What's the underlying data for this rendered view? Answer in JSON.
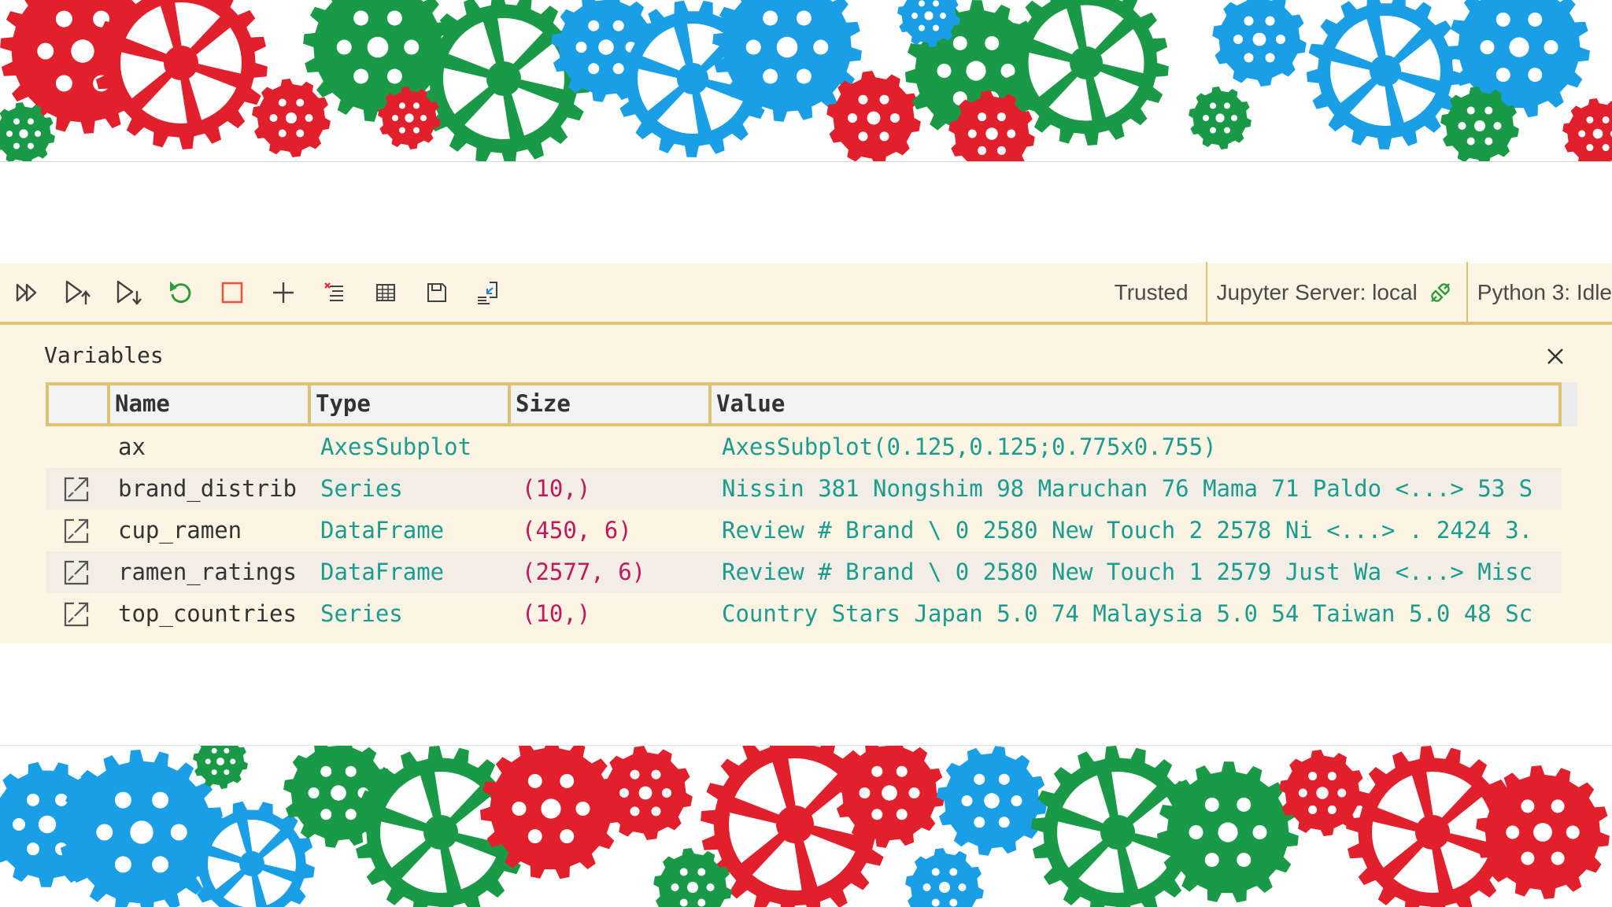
{
  "toolbar": {
    "buttons": [
      {
        "name": "run-all-icon"
      },
      {
        "name": "run-above-icon"
      },
      {
        "name": "run-below-icon"
      },
      {
        "name": "restart-kernel-icon"
      },
      {
        "name": "interrupt-kernel-icon"
      },
      {
        "name": "add-cell-icon"
      },
      {
        "name": "clear-outputs-icon"
      },
      {
        "name": "variables-icon"
      },
      {
        "name": "save-icon"
      },
      {
        "name": "export-icon"
      }
    ],
    "trusted": "Trusted",
    "server": "Jupyter Server: local",
    "kernel": "Python 3: Idle"
  },
  "variables": {
    "title": "Variables",
    "columns": [
      "Name",
      "Type",
      "Size",
      "Value"
    ],
    "rows": [
      {
        "name": "ax",
        "type": "AxesSubplot",
        "size": "",
        "value": "AxesSubplot(0.125,0.125;0.775x0.755)",
        "expandable": false
      },
      {
        "name": "brand_distrib",
        "type": "Series",
        "size": "(10,)",
        "value": "Nissin 381 Nongshim 98 Maruchan 76 Mama 71 Paldo <...> 53 S",
        "expandable": true
      },
      {
        "name": "cup_ramen",
        "type": "DataFrame",
        "size": "(450, 6)",
        "value": "Review # Brand \\ 0 2580 New Touch 2 2578 Ni <...> . 2424 3.",
        "expandable": true
      },
      {
        "name": "ramen_ratings",
        "type": "DataFrame",
        "size": "(2577, 6)",
        "value": "Review # Brand \\ 0 2580 New Touch 1 2579 Just Wa <...> Misc",
        "expandable": true
      },
      {
        "name": "top_countries",
        "type": "Series",
        "size": "(10,)",
        "value": "Country Stars Japan 5.0 74 Malaysia 5.0 54 Taiwan 5.0 48 Sc",
        "expandable": true
      }
    ]
  },
  "colors": {
    "accent_border": "#dcc272",
    "panel_bg": "#fdf4e4",
    "type_color": "#1a9c8e",
    "size_color": "#c2185b",
    "gear_red": "#e2202c",
    "gear_green": "#1a9a46",
    "gear_blue": "#1a9ee6"
  }
}
